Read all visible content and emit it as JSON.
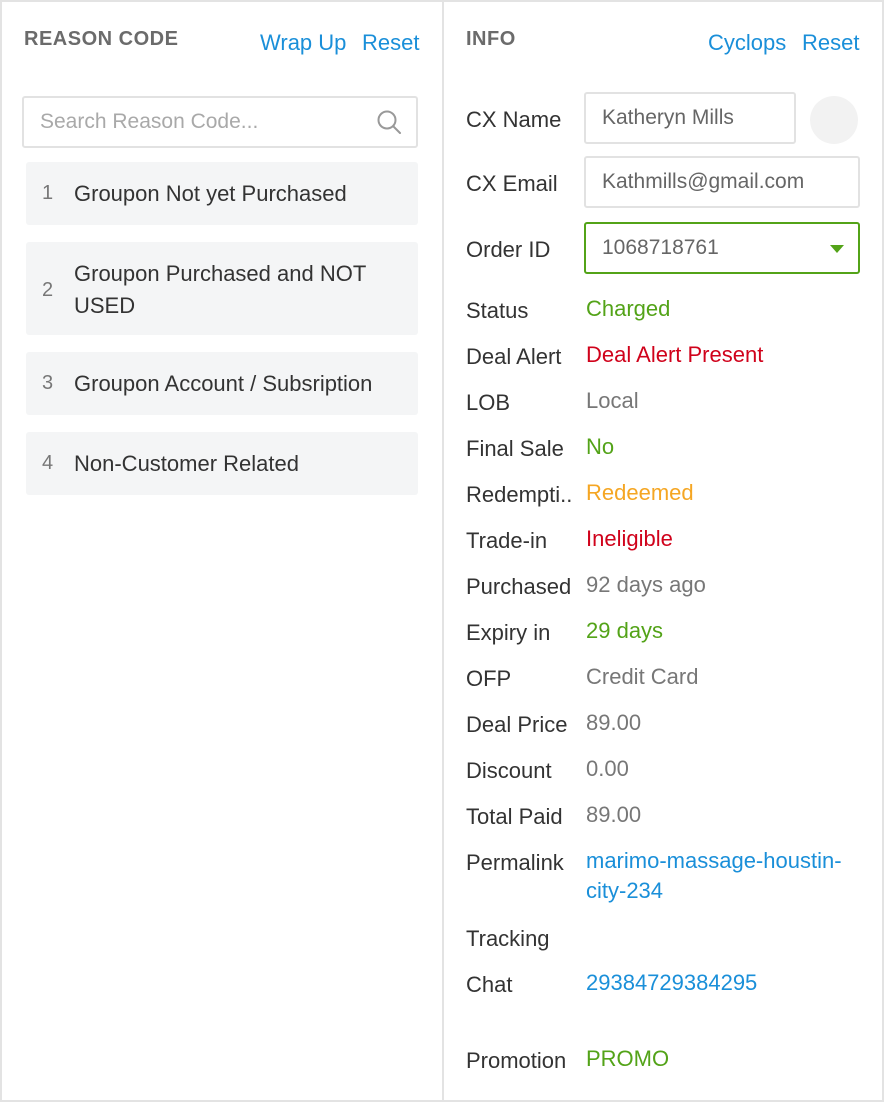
{
  "reason_panel": {
    "title": "REASON CODE",
    "wrap_up_label": "Wrap Up",
    "reset_label": "Reset",
    "search_placeholder": "Search Reason Code...",
    "items": [
      {
        "num": "1",
        "label": "Groupon Not yet Purchased"
      },
      {
        "num": "2",
        "label": "Groupon Purchased and NOT USED"
      },
      {
        "num": "3",
        "label": "Groupon Account / Subsription"
      },
      {
        "num": "4",
        "label": "Non-Customer Related"
      }
    ]
  },
  "info_panel": {
    "title": "INFO",
    "cyclops_label": "Cyclops",
    "reset_label": "Reset",
    "cx_name_label": "CX Name",
    "cx_name_value": "Katheryn Mills",
    "cx_email_label": "CX Email",
    "cx_email_value": "Kathmills@gmail.com",
    "order_id_label": "Order ID",
    "order_id_value": "1068718761",
    "rows": [
      {
        "label": "Status",
        "value": "Charged",
        "color": "#53a318"
      },
      {
        "label": "Deal Alert",
        "value": "Deal Alert Present",
        "color": "#d0021b"
      },
      {
        "label": "LOB",
        "value": "Local",
        "color": "#777777"
      },
      {
        "label": "Final Sale",
        "value": "No",
        "color": "#53a318"
      },
      {
        "label": "Redempti..",
        "value": "Redeemed",
        "color": "#f5a623"
      },
      {
        "label": "Trade-in",
        "value": "Ineligible",
        "color": "#d0021b"
      },
      {
        "label": "Purchased",
        "value": "92 days ago",
        "color": "#777777"
      },
      {
        "label": "Expiry in",
        "value": "29 days",
        "color": "#53a318"
      },
      {
        "label": "OFP",
        "value": "Credit Card",
        "color": "#777777"
      },
      {
        "label": "Deal Price",
        "value": "89.00",
        "color": "#777777"
      },
      {
        "label": "Discount",
        "value": "0.00",
        "color": "#777777"
      },
      {
        "label": "Total Paid",
        "value": "89.00",
        "color": "#777777"
      },
      {
        "label": "Permalink",
        "value": "marimo-massage-houstin-city-234",
        "color": "#1a8fd9"
      },
      {
        "label": "Tracking",
        "value": "",
        "color": "#777777"
      },
      {
        "label": "Chat",
        "value": "29384729384295",
        "color": "#1a8fd9"
      },
      {
        "label": "Promotion",
        "value": "PROMO",
        "color": "#53a318"
      }
    ]
  }
}
